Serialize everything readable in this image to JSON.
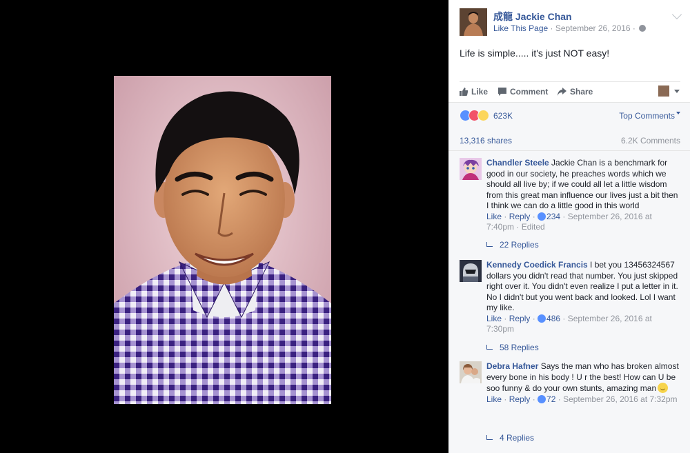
{
  "post": {
    "page_name": "成龍 Jackie Chan",
    "like_page": "Like This Page",
    "separator": " · ",
    "date": "September 26, 2016",
    "meta_suffix": " · ",
    "text": "Life is simple..... it's just NOT easy!"
  },
  "actions": {
    "like": "Like",
    "comment": "Comment",
    "share": "Share"
  },
  "summary": {
    "reaction_count": "623K",
    "top_comments": "Top Comments",
    "shares": "13,316 shares",
    "comments": "6.2K Comments"
  },
  "comments": [
    {
      "author": "Chandler Steele",
      "text": " Jackie Chan is a benchmark for good in our society, he preaches words which we should all live by; if we could all let a little wisdom from this great man influence our lives just a bit then I think we can do a little good in this world",
      "like": "Like",
      "reply": "Reply",
      "sep": " · ",
      "likes": "234",
      "time": "September 26, 2016 at 7:40pm",
      "edited": "Edited",
      "replies": "22 Replies"
    },
    {
      "author": "Kennedy Coedick Francis",
      "text": " I bet you 13456324567 dollars you didn't read that number. You just skipped right over it. You didn't even realize I put a letter in it. No I didn't but you went back and looked. Lol I want my like.",
      "like": "Like",
      "reply": "Reply",
      "sep": " · ",
      "likes": "486",
      "time": "September 26, 2016 at 7:30pm",
      "replies": "58 Replies"
    },
    {
      "author": "Debra Hafner",
      "text": " Says the man who has broken almost every bone in his body ! U r the best! How can U be soo funny & do your own stunts, amazing man",
      "like": "Like",
      "reply": "Reply",
      "sep": " · ",
      "likes": "72",
      "time": "September 26, 2016 at 7:32pm",
      "replies": "4 Replies"
    }
  ],
  "colors": {
    "link": "#365899",
    "muted": "#90949c",
    "panel_bg": "#ffffff",
    "summary_bg": "#f6f7f9"
  }
}
